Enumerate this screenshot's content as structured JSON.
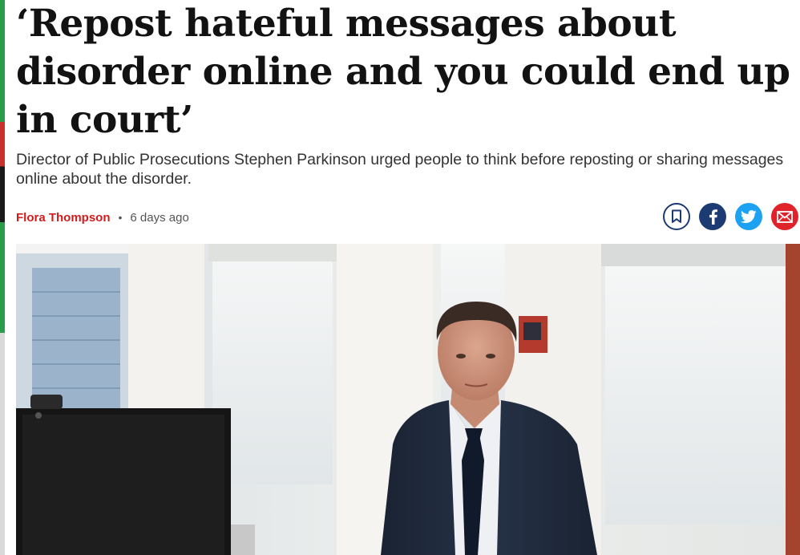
{
  "article": {
    "headline": "‘Repost hateful messages about disorder online and you could end up in court’",
    "standfirst": "Director of Public Prosecutions Stephen Parkinson urged people to think before reposting or sharing messages online about the disorder.",
    "author": "Flora Thompson",
    "separator": "•",
    "published": "6 days ago"
  },
  "share": {
    "buttons": [
      {
        "name": "bookmark",
        "icon": "bookmark-icon"
      },
      {
        "name": "facebook",
        "icon": "facebook-icon"
      },
      {
        "name": "twitter",
        "icon": "twitter-icon"
      },
      {
        "name": "email",
        "icon": "email-icon"
      }
    ]
  },
  "colors": {
    "author": "#d21c1c",
    "facebook": "#1d3b73",
    "twitter": "#1da1f2",
    "email": "#e0222a",
    "headline": "#121212"
  }
}
